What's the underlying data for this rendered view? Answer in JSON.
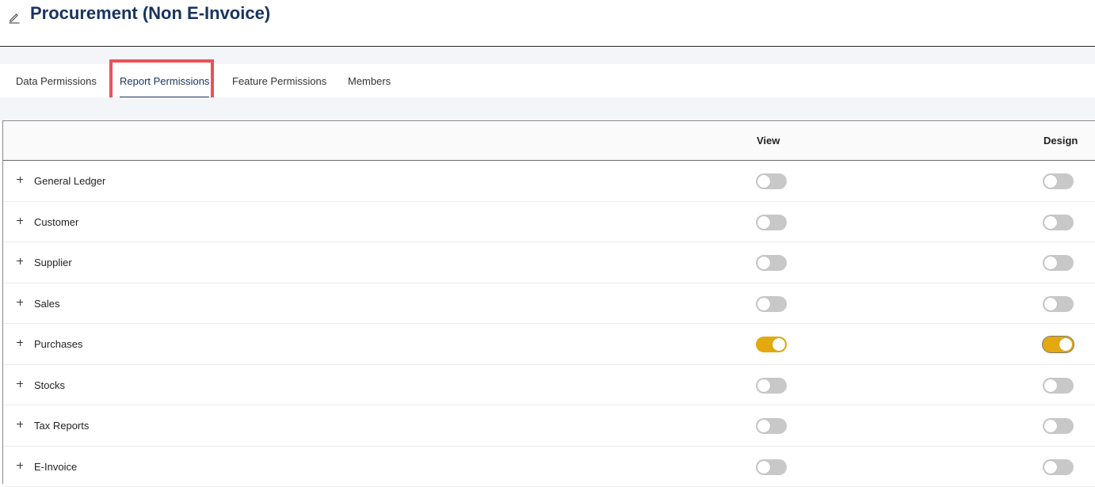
{
  "page": {
    "title": "Procurement (Non E-Invoice)",
    "edit_icon": "pencil-icon"
  },
  "tabs": [
    {
      "label": "Data Permissions",
      "active": false
    },
    {
      "label": "Report Permissions",
      "active": true
    },
    {
      "label": "Feature Permissions",
      "active": false
    },
    {
      "label": "Members",
      "active": false
    }
  ],
  "table": {
    "columns": {
      "name": "",
      "view": "View",
      "design": "Design"
    },
    "rows": [
      {
        "label": "General Ledger",
        "view": false,
        "design": false
      },
      {
        "label": "Customer",
        "view": false,
        "design": false
      },
      {
        "label": "Supplier",
        "view": false,
        "design": false
      },
      {
        "label": "Sales",
        "view": false,
        "design": false
      },
      {
        "label": "Purchases",
        "view": true,
        "design": true
      },
      {
        "label": "Stocks",
        "view": false,
        "design": false
      },
      {
        "label": "Tax Reports",
        "view": false,
        "design": false
      },
      {
        "label": "E-Invoice",
        "view": false,
        "design": false
      }
    ]
  },
  "colors": {
    "title": "#18335e",
    "toggle_on": "#e4a90f",
    "toggle_off": "#c8c8c8",
    "highlight": "#e8525a"
  }
}
